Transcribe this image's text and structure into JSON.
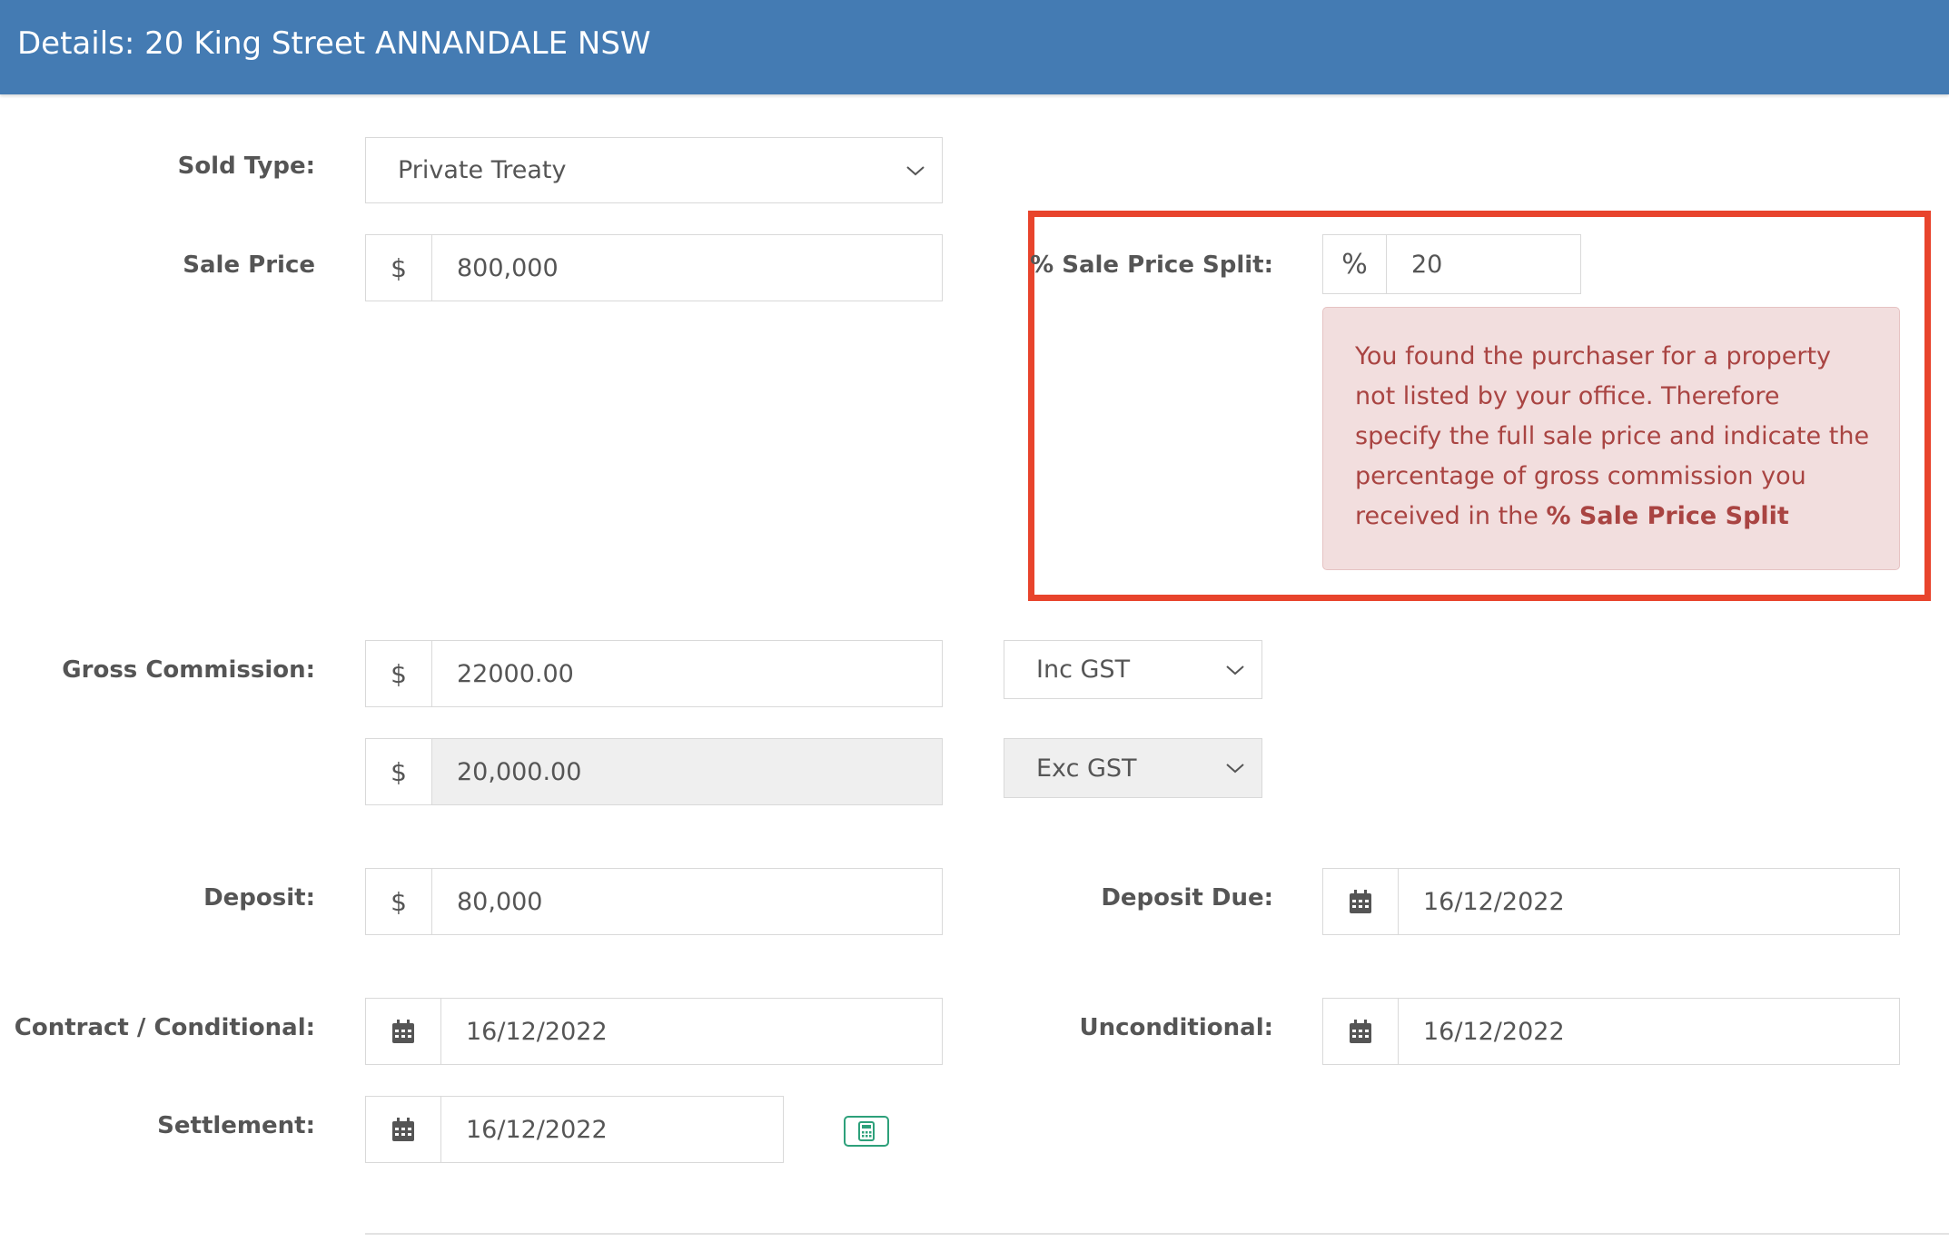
{
  "header": {
    "title": "Details: 20 King Street ANNANDALE NSW"
  },
  "sold_type": {
    "label": "Sold Type:",
    "value": "Private Treaty"
  },
  "sale_price": {
    "label": "Sale Price",
    "currency": "$",
    "value": "800,000"
  },
  "sale_price_split": {
    "label": "% Sale Price Split:",
    "symbol": "%",
    "value": "20",
    "alert_text": "You found the purchaser for a property not listed by your office. Therefore specify the full sale price and indicate the percentage of gross commission you received in the ",
    "alert_bold": "% Sale Price Split"
  },
  "gross_commission": {
    "label": "Gross Commission:",
    "currency": "$",
    "value": "22000.00",
    "gst_select": "Inc GST",
    "exc_currency": "$",
    "exc_value": "20,000.00",
    "exc_gst_select": "Exc GST"
  },
  "deposit": {
    "label": "Deposit:",
    "currency": "$",
    "value": "80,000"
  },
  "deposit_due": {
    "label": "Deposit Due:",
    "value": "16/12/2022"
  },
  "contract_conditional": {
    "label": "Contract / Conditional:",
    "value": "16/12/2022"
  },
  "unconditional": {
    "label": "Unconditional:",
    "value": "16/12/2022"
  },
  "settlement": {
    "label": "Settlement:",
    "value": "16/12/2022"
  },
  "icons": {
    "calendar": "calendar-icon",
    "calculator": "calculator-icon",
    "chevron": "chevron-down-icon"
  },
  "colors": {
    "header": "#447bb3",
    "highlight": "#e8442c",
    "alert_bg": "#f2dede",
    "alert_text": "#a94442",
    "calculator": "#2da07a"
  }
}
